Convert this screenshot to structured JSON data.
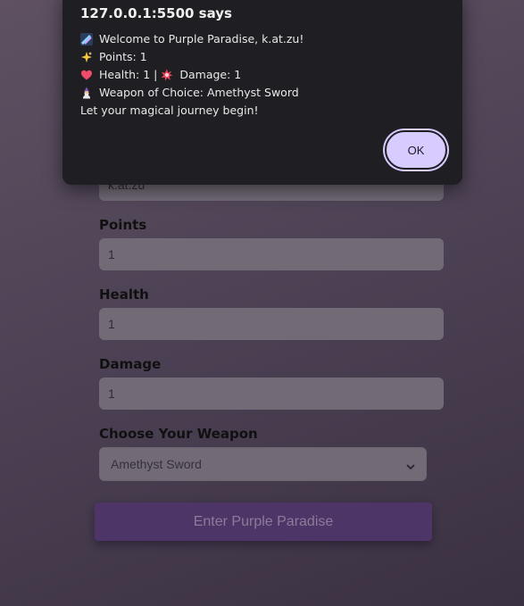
{
  "dialog": {
    "title": "127.0.0.1:5500 says",
    "lines": [
      {
        "icon": "comet-emoji-icon",
        "text": "Welcome to Purple Paradise, k.at.zu!"
      },
      {
        "icon": "sparkles-emoji-icon",
        "text": "Points: 1"
      },
      {
        "icon": "heart-emoji-icon",
        "text": "Health: 1 | ",
        "icon2": "explosion-emoji-icon",
        "text2": "Damage: 1"
      },
      {
        "icon": "mage-emoji-icon",
        "text": "Weapon of Choice: Amethyst Sword"
      },
      {
        "icon": "",
        "text": "Let your magical journey begin!"
      }
    ],
    "ok_label": "OK"
  },
  "form": {
    "name_value": "k.at.zu",
    "points_label": "Points",
    "points_value": "1",
    "health_label": "Health",
    "health_value": "1",
    "damage_label": "Damage",
    "damage_value": "1",
    "weapon_label": "Choose Your Weapon",
    "weapon_selected": "Amethyst Sword",
    "submit_label": "Enter Purple Paradise"
  },
  "colors": {
    "background": "#4e4356",
    "dialog_bg": "#1f1e22",
    "ok_button": "#d7cbff",
    "submit_button": "#4e3568"
  }
}
